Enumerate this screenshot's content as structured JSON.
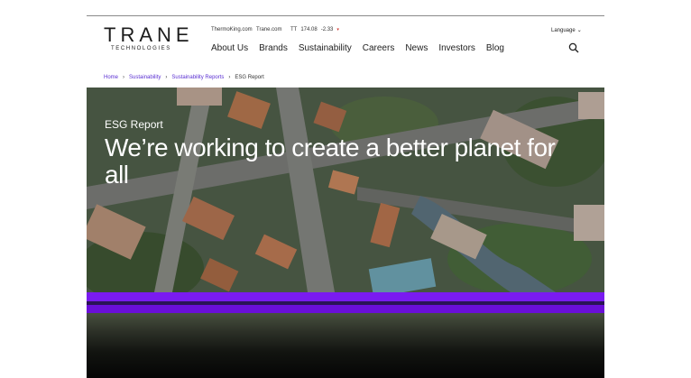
{
  "brand": {
    "name": "TRANE",
    "tagline": "TECHNOLOGIES"
  },
  "utility": {
    "links": [
      "ThermoKing.com",
      "Trane.com"
    ],
    "ticker": {
      "symbol": "TT",
      "price": "174.08",
      "change": "-2.33"
    },
    "language": "Language"
  },
  "nav": {
    "items": [
      "About Us",
      "Brands",
      "Sustainability",
      "Careers",
      "News",
      "Investors",
      "Blog"
    ]
  },
  "breadcrumb": {
    "items": [
      "Home",
      "Sustainability",
      "Sustainability Reports"
    ],
    "current": "ESG Report"
  },
  "hero": {
    "label": "ESG Report",
    "title": "We’re working to create a better planet for all"
  },
  "colors": {
    "accent": "#7a1bf0",
    "link": "#5a2fd2",
    "ticker_down": "#d0342c"
  },
  "icons": [
    "search-icon",
    "chevron-down-icon",
    "chevron-right-icon",
    "triangle-down-icon"
  ]
}
